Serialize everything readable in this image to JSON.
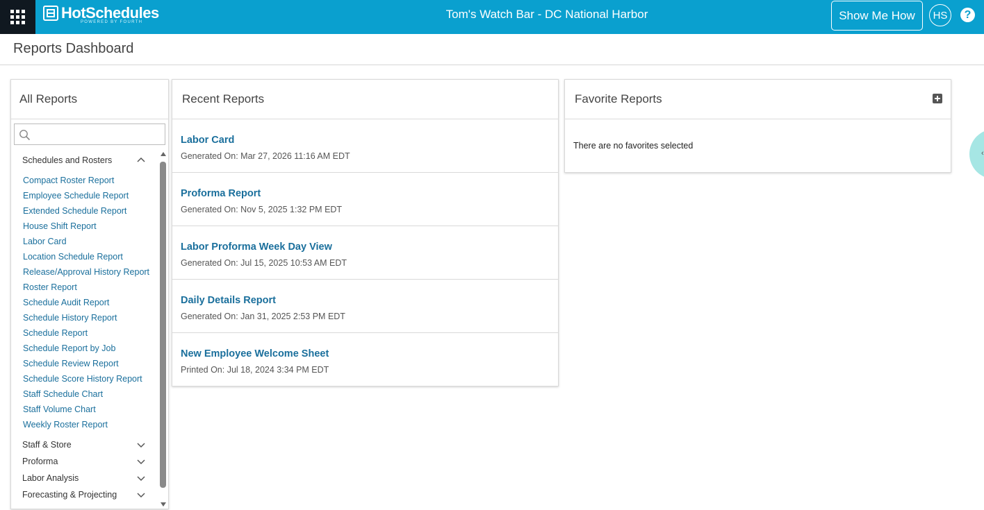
{
  "header": {
    "logo_text": "HotSchedules",
    "logo_sub": "POWERED BY FOURTH",
    "location": "Tom's Watch Bar - DC National Harbor",
    "show_me_how": "Show Me How",
    "avatar": "HS",
    "help": "?"
  },
  "page": {
    "title": "Reports Dashboard"
  },
  "all_reports": {
    "title": "All Reports",
    "search_placeholder": "",
    "open_category": "Schedules and Rosters",
    "reports": [
      "Compact Roster Report",
      "Employee Schedule Report",
      "Extended Schedule Report",
      "House Shift Report",
      "Labor Card",
      "Location Schedule Report",
      "Release/Approval History Report",
      "Roster Report",
      "Schedule Audit Report",
      "Schedule History Report",
      "Schedule Report",
      "Schedule Report by Job",
      "Schedule Review Report",
      "Schedule Score History Report",
      "Staff Schedule Chart",
      "Staff Volume Chart",
      "Weekly Roster Report"
    ],
    "collapsed_categories": [
      "Staff & Store",
      "Proforma",
      "Labor Analysis",
      "Forecasting & Projecting"
    ]
  },
  "recent_reports": {
    "title": "Recent Reports",
    "items": [
      {
        "name": "Labor Card",
        "meta": "Generated On: Mar 27, 2026 11:16 AM EDT"
      },
      {
        "name": "Proforma Report",
        "meta": "Generated On: Nov 5, 2025 1:32 PM EDT"
      },
      {
        "name": "Labor Proforma Week Day View",
        "meta": "Generated On: Jul 15, 2025 10:53 AM EDT"
      },
      {
        "name": "Daily Details Report",
        "meta": "Generated On: Jan 31, 2025 2:53 PM EDT"
      },
      {
        "name": "New Employee Welcome Sheet",
        "meta": "Printed On: Jul 18, 2024 3:34 PM EDT"
      }
    ]
  },
  "favorite_reports": {
    "title": "Favorite Reports",
    "empty_text": "There are no favorites selected"
  },
  "side_bubble": {
    "glyph": "‹"
  },
  "colors": {
    "topbar": "#0aa0cf",
    "apps": "#101820",
    "link": "#1a6f9c"
  }
}
